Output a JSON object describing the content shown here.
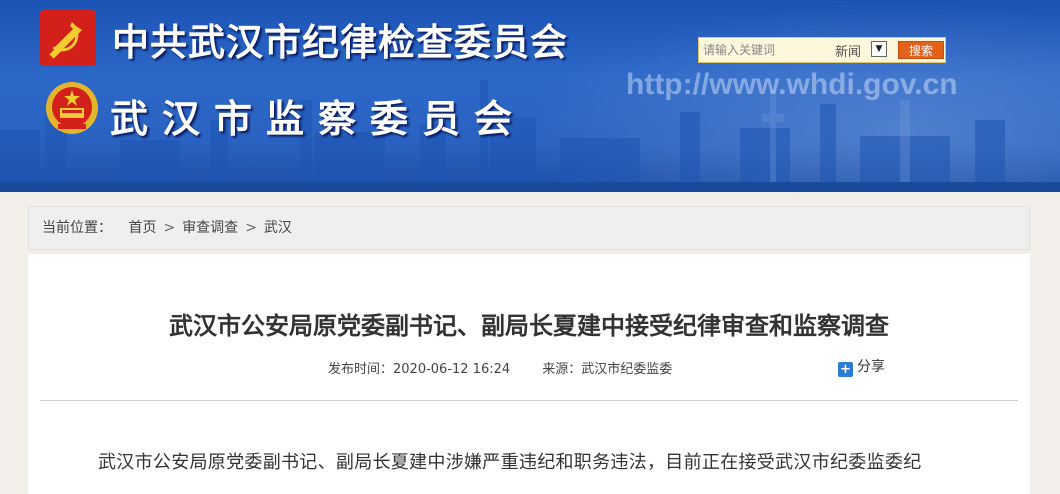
{
  "header": {
    "title_line_1": "中共武汉市纪律检查委员会",
    "title_line_2": "武汉市监察委员会",
    "site_url": "http://www.whdi.gov.cn"
  },
  "search": {
    "placeholder": "请输入关键词",
    "scope": "新闻",
    "button_label": "搜索"
  },
  "breadcrumb": {
    "label": "当前位置：",
    "items": [
      "首页",
      "审查调查",
      "武汉"
    ],
    "separator": ">"
  },
  "article": {
    "title": "武汉市公安局原党委副书记、副局长夏建中接受纪律审查和监察调查",
    "publish_time": "发布时间：2020-06-12 16:24",
    "source": "来源：武汉市纪委监委",
    "share_label": "分享",
    "body_first_line": "武汉市公安局原党委副书记、副局长夏建中涉嫌严重违纪和职务违法，目前正在接受武汉市纪委监委纪"
  },
  "colors": {
    "banner_blue": "#2a62c1",
    "search_button": "#e2621b",
    "share_icon": "#2b7cd3"
  },
  "icons": [
    "party-emblem-icon",
    "national-emblem-icon",
    "chevron-down-icon",
    "plus-icon"
  ]
}
